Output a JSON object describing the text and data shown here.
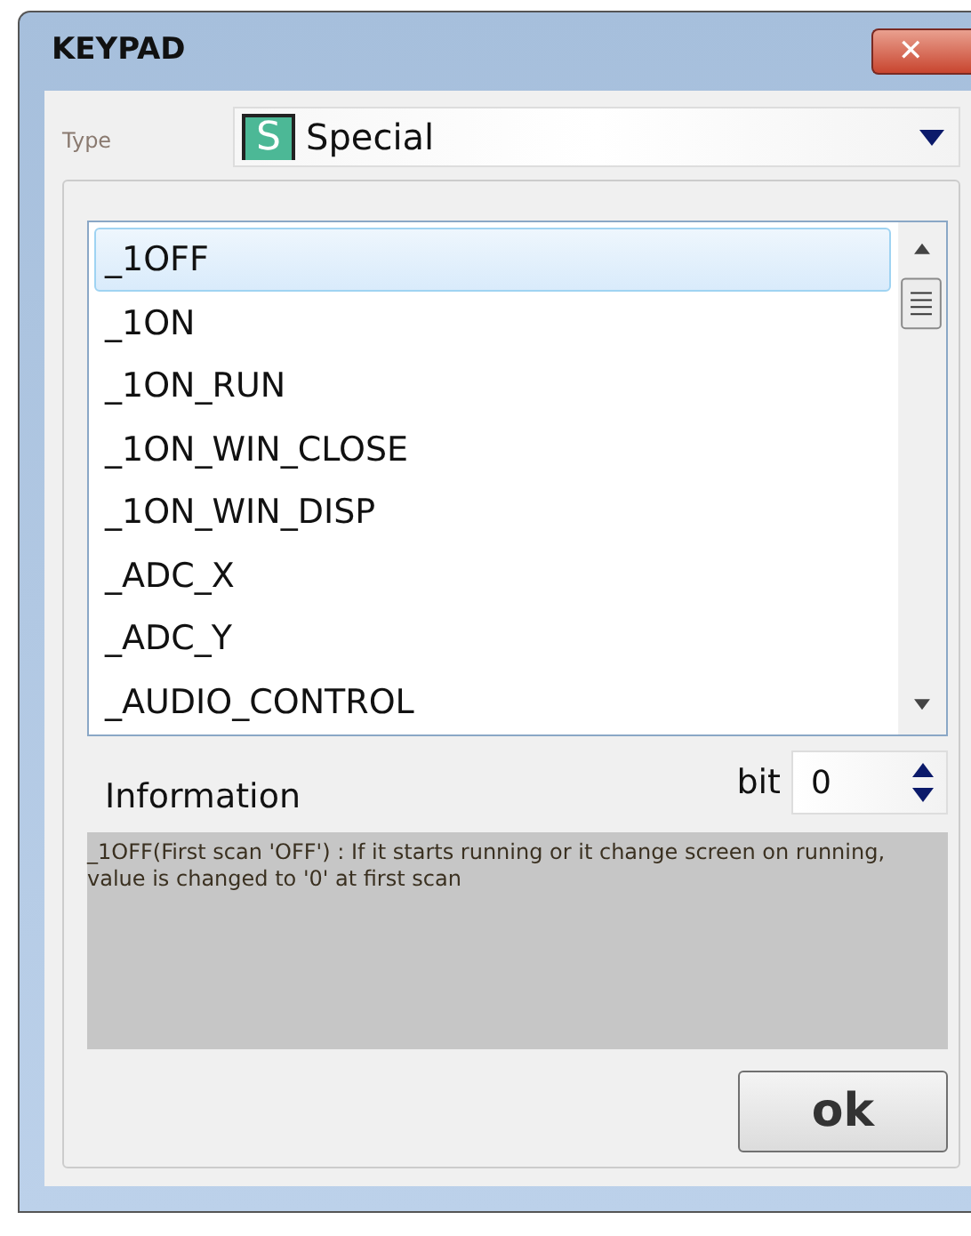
{
  "window": {
    "title": "KEYPAD",
    "close_glyph": "✕"
  },
  "type_field": {
    "label": "Type",
    "badge": "S",
    "value": "Special"
  },
  "list": [
    {
      "text": "_1OFF",
      "selected": true
    },
    {
      "text": "_1ON",
      "selected": false
    },
    {
      "text": "_1ON_RUN",
      "selected": false
    },
    {
      "text": "_1ON_WIN_CLOSE",
      "selected": false
    },
    {
      "text": "_1ON_WIN_DISP",
      "selected": false
    },
    {
      "text": "_ADC_X",
      "selected": false
    },
    {
      "text": "_ADC_Y",
      "selected": false
    },
    {
      "text": "_AUDIO_CONTROL",
      "selected": false
    }
  ],
  "bit": {
    "label": "bit",
    "value": "0"
  },
  "information": {
    "label": "Information",
    "text": "_1OFF(First scan 'OFF') : If it starts running or it change screen on running, value is changed to '0' at first scan"
  },
  "buttons": [
    {
      "label": "ok"
    }
  ]
}
